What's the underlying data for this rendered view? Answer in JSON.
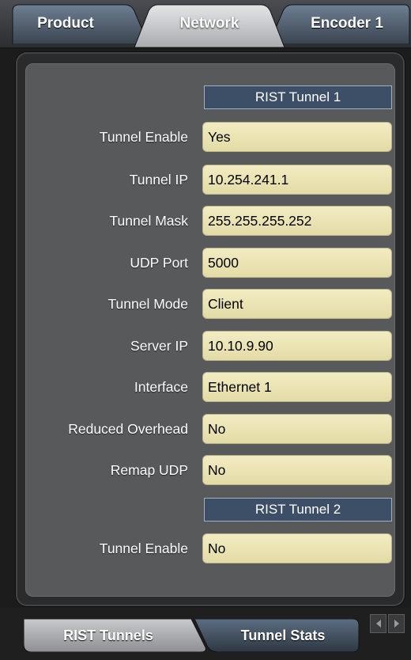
{
  "top_tabs": [
    {
      "label": "Product",
      "active": false
    },
    {
      "label": "Network",
      "active": true
    },
    {
      "label": "Encoder 1",
      "active": false
    }
  ],
  "sections": [
    {
      "header": "RIST Tunnel 1",
      "rows": [
        {
          "label": "Tunnel Enable",
          "value": "Yes"
        },
        {
          "label": "Tunnel IP",
          "value": "10.254.241.1"
        },
        {
          "label": "Tunnel Mask",
          "value": "255.255.255.252"
        },
        {
          "label": "UDP Port",
          "value": "5000"
        },
        {
          "label": "Tunnel Mode",
          "value": "Client"
        },
        {
          "label": "Server IP",
          "value": "10.10.9.90"
        },
        {
          "label": "Interface",
          "value": "Ethernet 1"
        },
        {
          "label": "Reduced Overhead",
          "value": "No"
        },
        {
          "label": "Remap UDP",
          "value": "No"
        }
      ]
    },
    {
      "header": "RIST Tunnel 2",
      "rows": [
        {
          "label": "Tunnel Enable",
          "value": "No"
        }
      ]
    }
  ],
  "bottom_tabs": [
    {
      "label": "RIST Tunnels",
      "active": true
    },
    {
      "label": "Tunnel Stats",
      "active": false
    }
  ],
  "scroll_arrows": {
    "left_icon": "arrow-left-icon",
    "right_icon": "arrow-right-icon"
  },
  "colors": {
    "field_bg": "#ece5b4",
    "header_bg": "#3c4f66",
    "panel_bg": "#58595b",
    "active_tab": "#c6c7c9"
  }
}
